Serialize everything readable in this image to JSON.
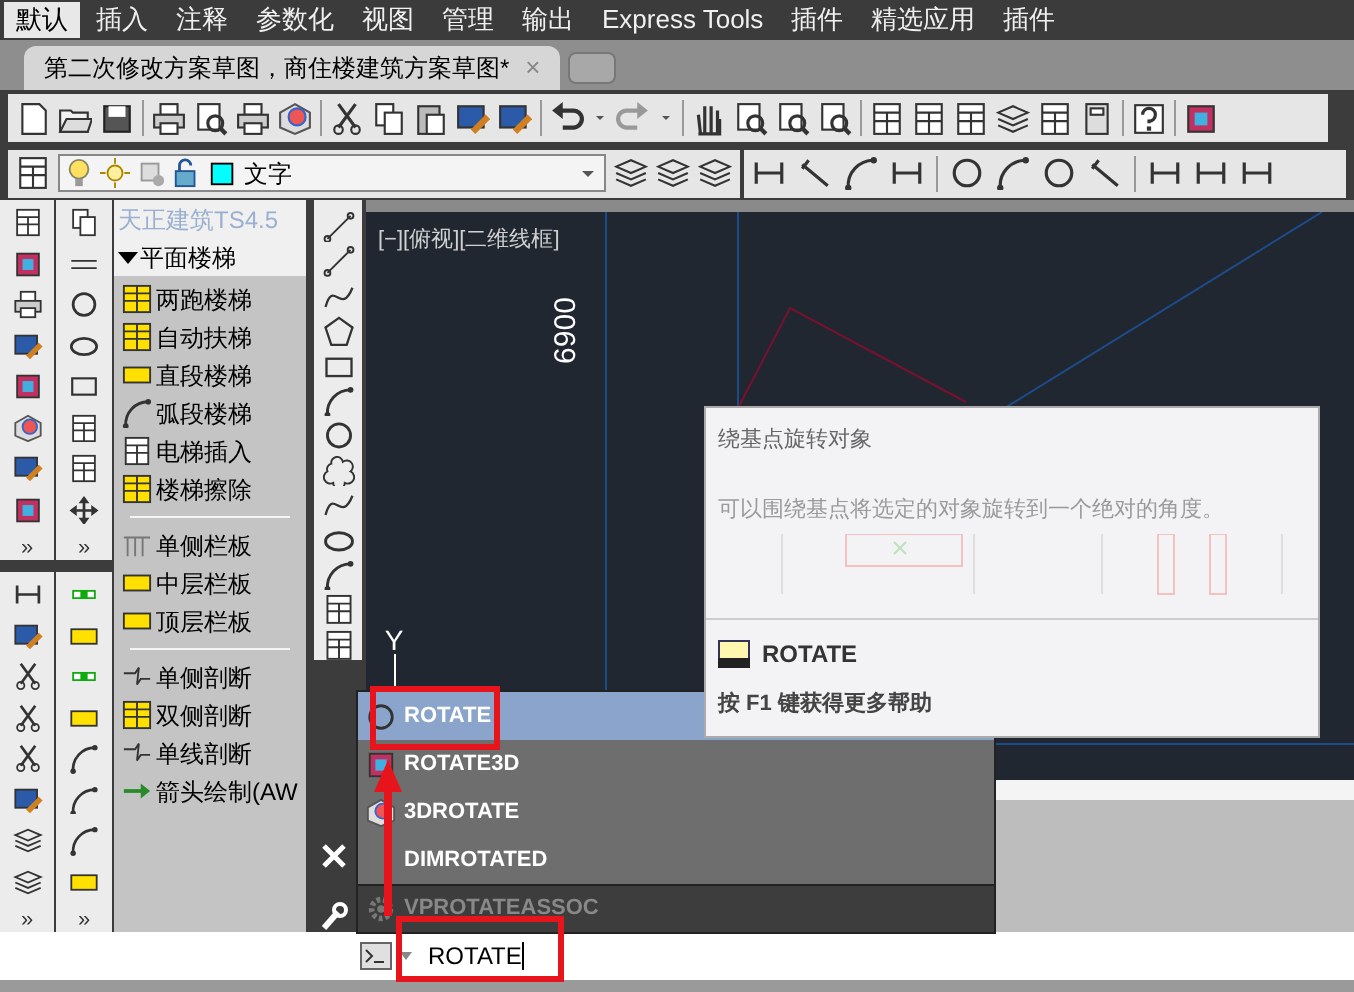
{
  "menu_tabs": [
    {
      "label": "默认",
      "selected": true
    },
    {
      "label": "插入",
      "selected": false
    },
    {
      "label": "注释",
      "selected": false
    },
    {
      "label": "参数化",
      "selected": false
    },
    {
      "label": "视图",
      "selected": false
    },
    {
      "label": "管理",
      "selected": false
    },
    {
      "label": "输出",
      "selected": false
    },
    {
      "label": "Express Tools",
      "selected": false
    },
    {
      "label": "插件",
      "selected": false
    },
    {
      "label": "精选应用",
      "selected": false
    },
    {
      "label": "插件",
      "selected": false
    }
  ],
  "document_tab": {
    "title": "第二次修改方案草图，商住楼建筑方案草图*",
    "close": "×"
  },
  "layer_dropdown": {
    "value": "文字"
  },
  "left_toolbars": [
    {
      "more": "»"
    },
    {
      "more": "»"
    },
    {
      "more": "»"
    },
    {
      "more": "»"
    }
  ],
  "palette": {
    "title": "天正建筑TS4.5",
    "section": {
      "label": "平面楼梯",
      "expanded": true
    },
    "groups": [
      [
        "两跑楼梯",
        "自动扶梯",
        "直段楼梯",
        "弧段楼梯",
        "电梯插入",
        "楼梯擦除"
      ],
      [
        "单侧栏板",
        "中层栏板",
        "顶层栏板"
      ],
      [
        "单侧剖断",
        "双侧剖断",
        "单线剖断",
        "箭头绘制(AW"
      ]
    ]
  },
  "viewport": {
    "label": "[−][俯视][二维线框]",
    "dimension": "6900",
    "axis_label": "Y"
  },
  "tooltip": {
    "title": "绕基点旋转对象",
    "description": "可以围绕基点将选定的对象旋转到一个绝对的角度。",
    "command": "ROTATE",
    "help": "按 F1 键获得更多帮助"
  },
  "autocomplete": [
    {
      "label": "ROTATE",
      "selected": true,
      "disabled": false
    },
    {
      "label": "ROTATE3D",
      "selected": false,
      "disabled": false
    },
    {
      "label": "3DROTATE",
      "selected": false,
      "disabled": false
    },
    {
      "label": "DIMROTATED",
      "selected": false,
      "disabled": false
    },
    {
      "label": "VPROTATEASSOC",
      "selected": false,
      "disabled": true
    }
  ],
  "command_line": {
    "value": "ROTATE"
  }
}
